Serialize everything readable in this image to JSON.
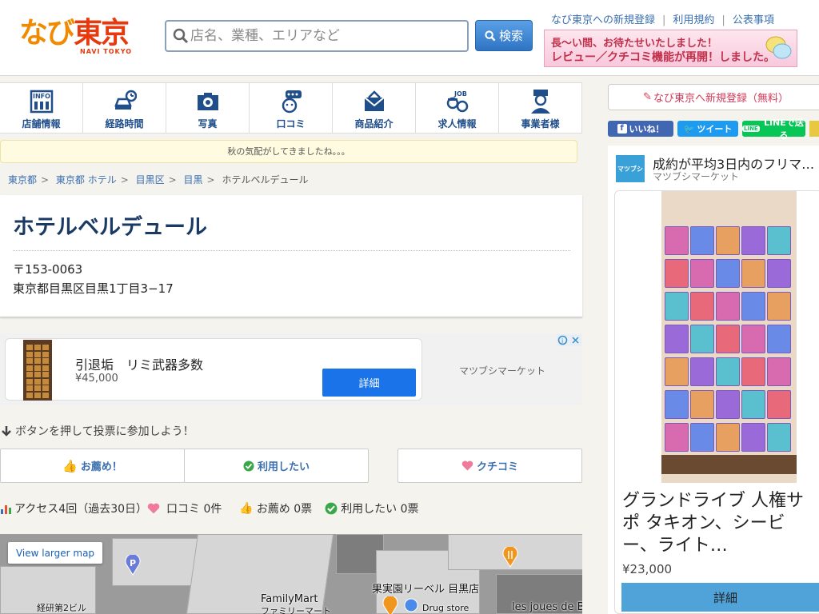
{
  "header": {
    "logo_text_1": "なび",
    "logo_text_2": "東京",
    "logo_sub": "NAVI TOKYO",
    "search_placeholder": "店名、業種、エリアなど",
    "search_button": "検索",
    "links": [
      "なび東京への新規登録",
      "利用規約",
      "公表事項"
    ],
    "promo_line1": "長〜い間、お待たせいたしました！",
    "promo_line2": "レビュー／クチコミ機能が再開！しました。"
  },
  "tabs": [
    {
      "label": "店舗情報",
      "icon": "info-icon"
    },
    {
      "label": "経路時間",
      "icon": "car-icon"
    },
    {
      "label": "写真",
      "icon": "camera-icon"
    },
    {
      "label": "口コミ",
      "icon": "chat-icon"
    },
    {
      "label": "商品紹介",
      "icon": "product-icon"
    },
    {
      "label": "求人情報",
      "icon": "job-icon"
    },
    {
      "label": "事業者様",
      "icon": "business-icon"
    }
  ],
  "notice": "秋の気配がしてきましたね。。。",
  "breadcrumb": [
    "東京都",
    "東京都 ホテル",
    "目黒区",
    "目黒",
    "ホテルベルデュール"
  ],
  "hotel": {
    "name": "ホテルベルデュール",
    "zip": "〒153-0063",
    "address": "東京都目黒区目黒1丁目3−17"
  },
  "ad": {
    "title": "引退垢　リミ武器多数",
    "price": "¥45,000",
    "button": "詳細",
    "seller": "マツブシマーケット"
  },
  "vote": {
    "hint": "ボタンを押して投票に参加しよう！",
    "recommend": "お薦め！",
    "want_use": "利用したい",
    "review": "クチコミ"
  },
  "stats": {
    "access": "アクセス4回（過去30日）",
    "reviews": "口コミ 0件",
    "recommend": "お薦め 0票",
    "want_use": "利用したい 0票"
  },
  "map": {
    "larger_map": "View larger map",
    "labels": [
      "FamilyMart",
      "ファミリーマート",
      "果実園リーベル 目黒店",
      "Drug store",
      "les joues de Bé",
      "経研第2ビル"
    ]
  },
  "sidebar": {
    "register": "なび東京へ新規登録（無料）",
    "like": "いいね！",
    "tweet": "ツイート",
    "line": "LINEで送る",
    "ad_logo": "マツブシ",
    "ad_title": "成約が平均3日内のフリマ…",
    "ad_sub": "マツブシマーケット",
    "ad_headline": "グランドライブ 人権サポ タキオン、シービー、ライト…",
    "ad_price": "¥23,000",
    "ad_button": "詳細"
  }
}
